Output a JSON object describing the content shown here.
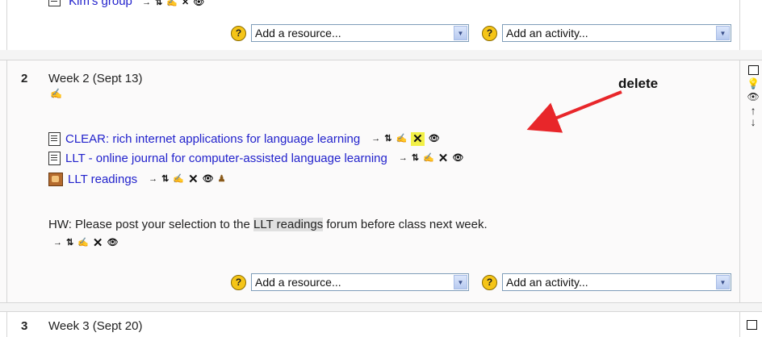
{
  "top_section": {
    "group_text": "Kim's group",
    "resource_select": "Add a resource...",
    "activity_select": "Add an activity..."
  },
  "section2": {
    "number": "2",
    "title": "Week 2 (Sept 13)",
    "items": [
      {
        "label": "CLEAR: rich internet applications for language learning",
        "icon": "document-icon"
      },
      {
        "label": "LLT - online journal for computer-assisted language learning",
        "icon": "document-icon"
      },
      {
        "label": "LLT readings",
        "icon": "forum-icon"
      }
    ],
    "hw_prefix": "HW: Please post your selection to the ",
    "hw_forum": "LLT readings",
    "hw_suffix": " forum before class next week.",
    "resource_select": "Add a resource...",
    "activity_select": "Add an activity..."
  },
  "section3": {
    "number": "3",
    "title": "Week 3 (Sept 20)"
  },
  "annotation": {
    "label": "delete",
    "arrow_color": "#e8262a",
    "highlight_color": "#f2f046"
  },
  "icons": {
    "move": "→",
    "updown": "⇅",
    "edit": "✍",
    "delete": "✕",
    "show": "👁",
    "group": "♟",
    "help": "?",
    "dropdown": "▼",
    "right_up": "↑",
    "right_down": "↓",
    "bulb": "💡"
  }
}
